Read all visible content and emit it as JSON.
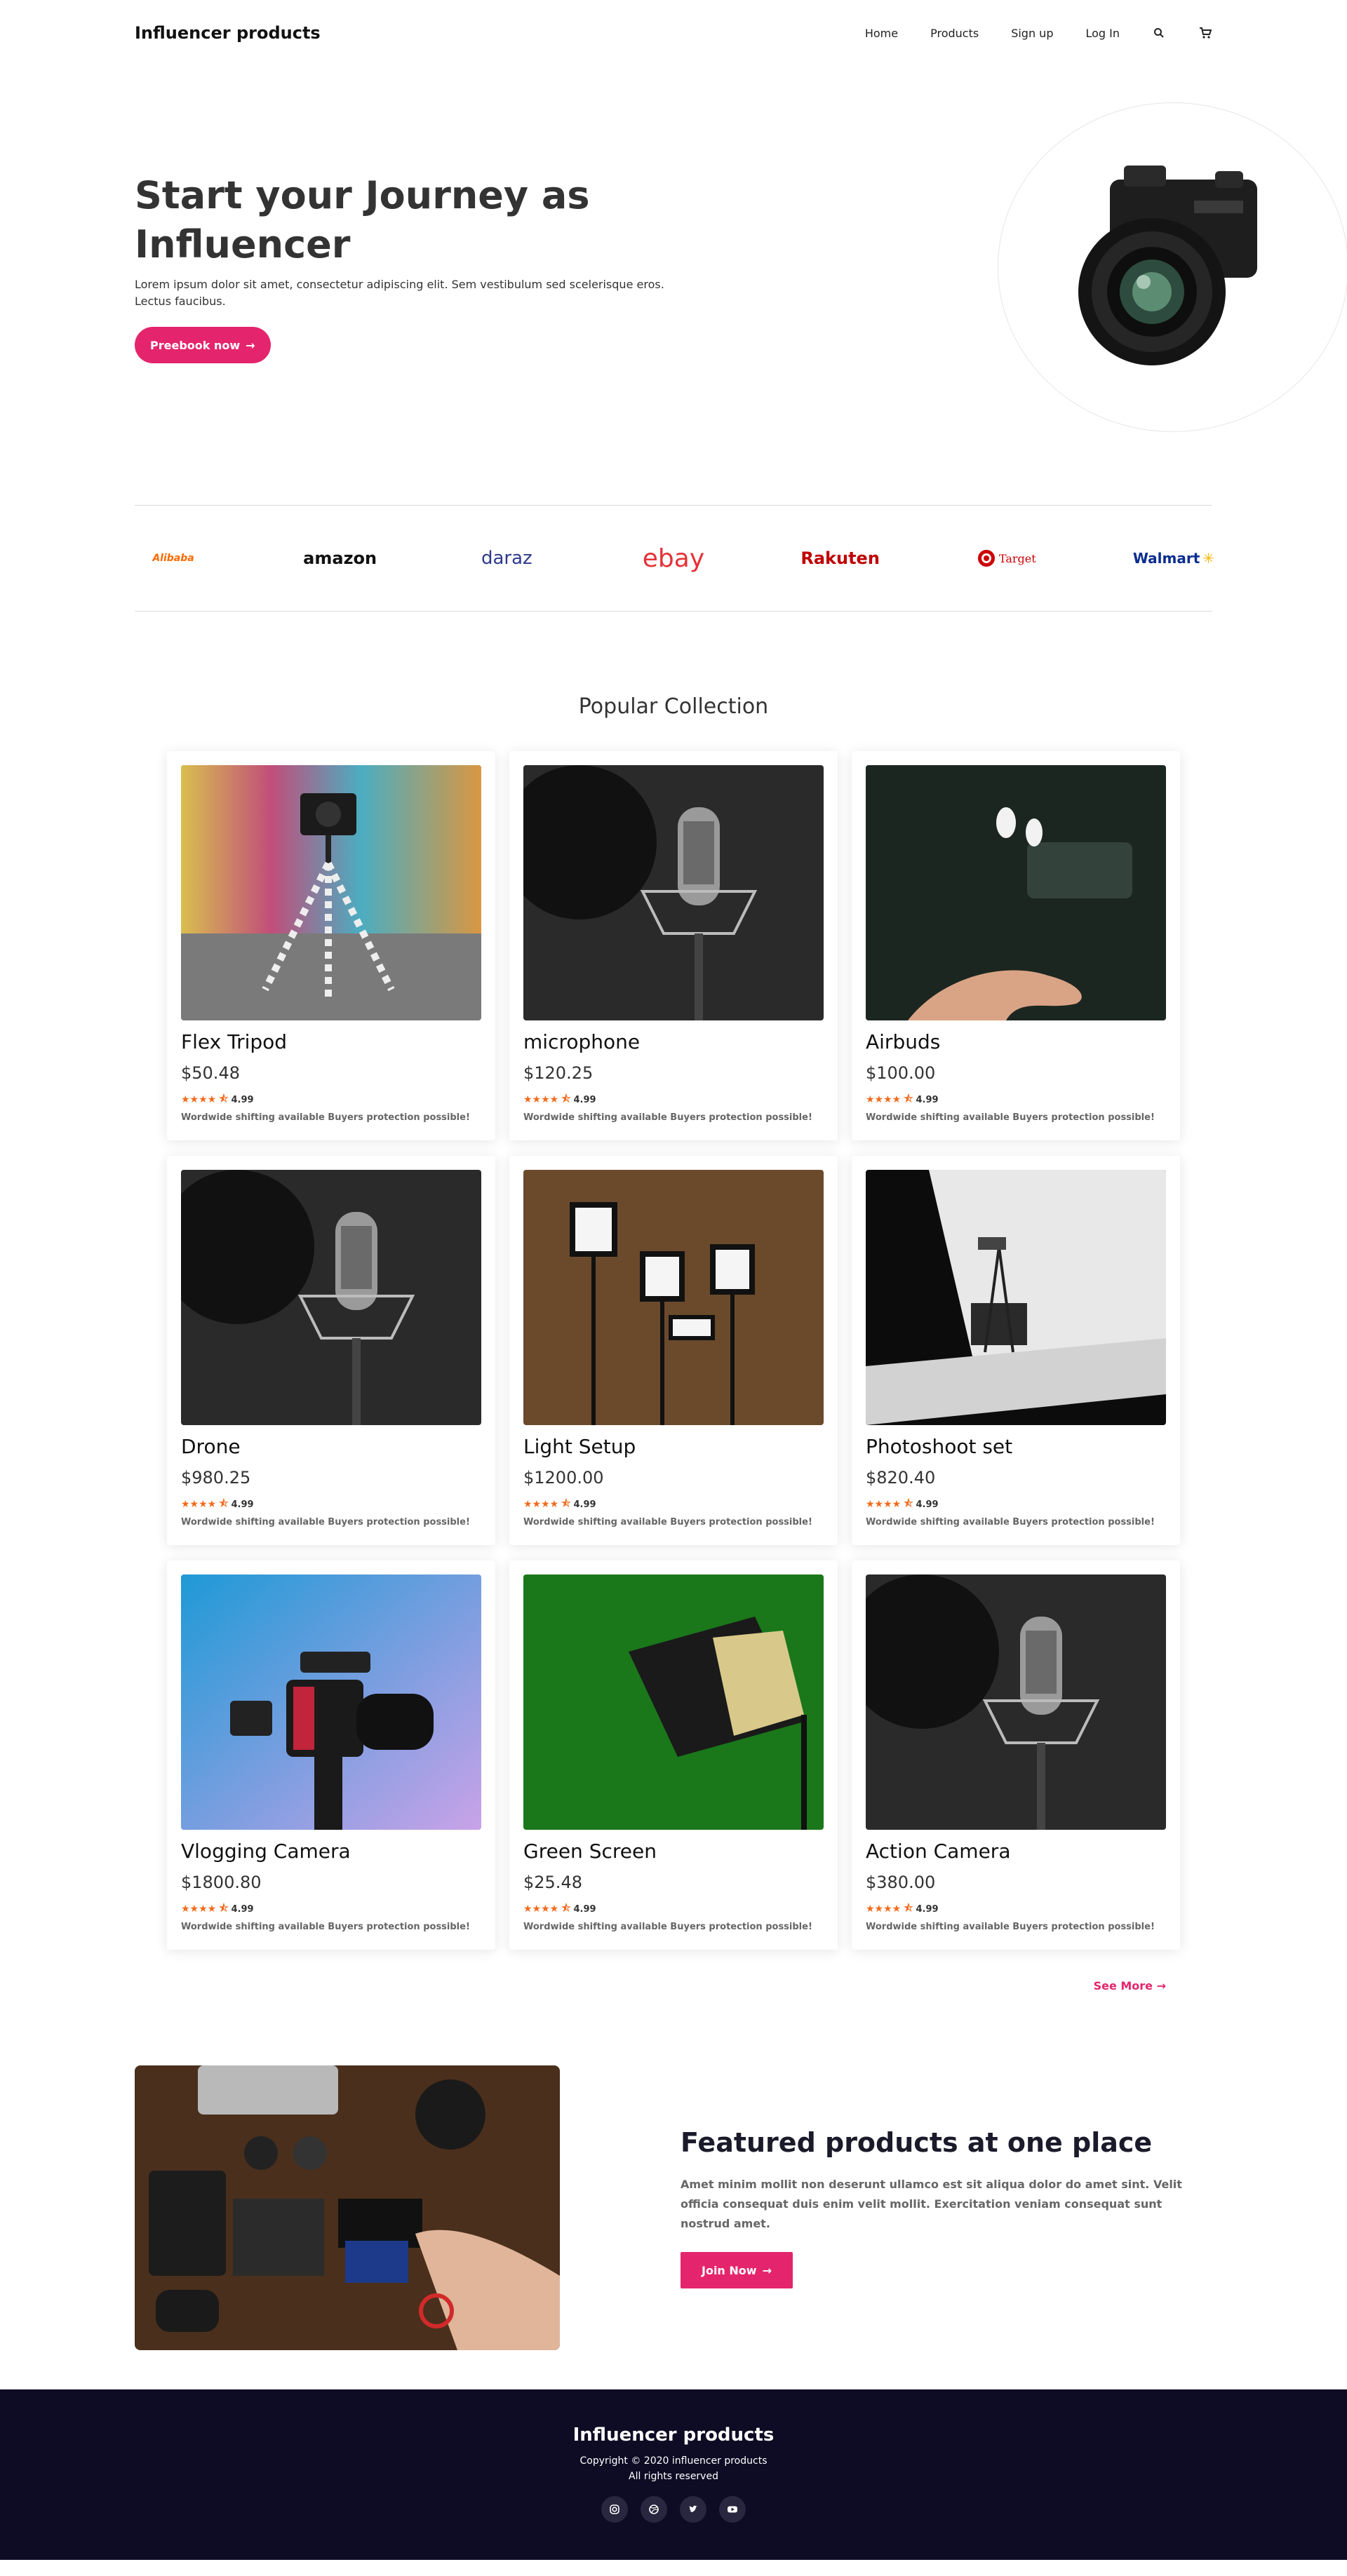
{
  "nav": {
    "brand": "Influencer products",
    "links": [
      "Home",
      "Products",
      "Sign up",
      "Log In"
    ],
    "icons": [
      "search-icon",
      "cart-icon"
    ]
  },
  "hero": {
    "title": "Start your Journey as Influencer",
    "subtitle": "Lorem ipsum dolor sit amet, consectetur adipiscing elit. Sem vestibulum sed scelerisque eros. Lectus faucibus.",
    "button": "Preebook now"
  },
  "brands": [
    {
      "name": "Alibaba",
      "color": "#ff6a00"
    },
    {
      "name": "amazon",
      "color": "#111111"
    },
    {
      "name": "daraz",
      "color": "#2e3a8c"
    },
    {
      "name": "ebay",
      "color": "#e53238"
    },
    {
      "name": "Rakuten",
      "color": "#bf0000"
    },
    {
      "name": "Target",
      "color": "#cc0000"
    },
    {
      "name": "Walmart",
      "color": "#0a2d8f"
    }
  ],
  "collection": {
    "title": "Popular Collection",
    "rating": "4.99",
    "note": "Wordwide shifting available Buyers protection possible!",
    "products": [
      {
        "name": "Flex Tripod",
        "price": "$50.48"
      },
      {
        "name": "microphone",
        "price": "$120.25"
      },
      {
        "name": "Airbuds",
        "price": "$100.00"
      },
      {
        "name": "Drone",
        "price": "$980.25"
      },
      {
        "name": "Light Setup",
        "price": "$1200.00"
      },
      {
        "name": "Photoshoot set",
        "price": "$820.40"
      },
      {
        "name": "Vlogging Camera",
        "price": "$1800.80"
      },
      {
        "name": "Green Screen",
        "price": "$25.48"
      },
      {
        "name": "Action Camera",
        "price": "$380.00"
      }
    ],
    "see_more": "See More"
  },
  "featured": {
    "title": "Featured products at one place",
    "description": "Amet minim mollit non deserunt ullamco est sit aliqua dolor do amet sint. Velit officia consequat duis enim velit mollit. Exercitation veniam consequat sunt nostrud amet.",
    "button": "Join Now"
  },
  "footer": {
    "brand": "Influencer products",
    "copyright": "Copyright © 2020 influencer products",
    "rights": "All rights reserved",
    "socials": [
      "instagram-icon",
      "dribbble-icon",
      "twitter-icon",
      "youtube-icon"
    ]
  },
  "colors": {
    "accent": "#e4256d",
    "star": "#f26a1b",
    "footer_bg": "#0e0b24"
  }
}
